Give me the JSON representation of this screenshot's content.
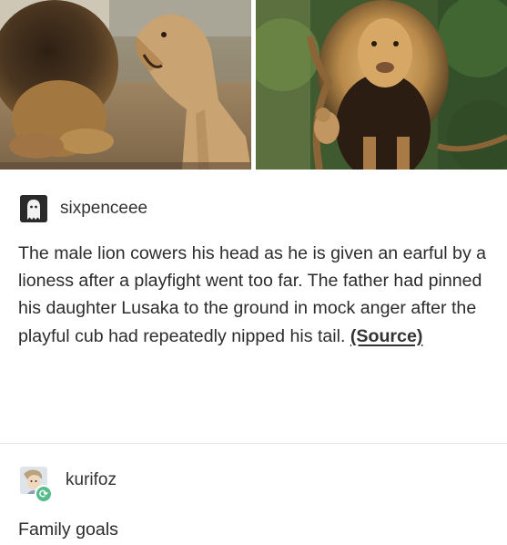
{
  "post": {
    "username": "sixpenceee",
    "avatar_icon": "ghost-icon",
    "text": "The male lion cowers his head as he is given an earful by a lioness after a playfight went too far. The father had pinned his daughter Lusaka to the ground in mock anger after the playful cub had repeatedly nipped his tail. ",
    "source_label": "(Source)"
  },
  "reblog": {
    "username": "kurifoz",
    "badge_icon": "reblog-icon",
    "text": "Family goals"
  },
  "colors": {
    "reblog_badge": "#56bc8a",
    "text": "#2c2c2c"
  }
}
